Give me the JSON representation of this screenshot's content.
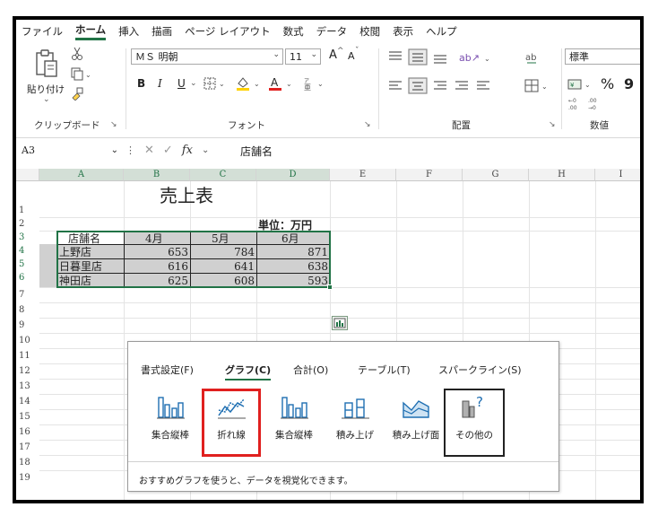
{
  "menu": {
    "items": [
      "ファイル",
      "ホーム",
      "挿入",
      "描画",
      "ページ レイアウト",
      "数式",
      "データ",
      "校閲",
      "表示",
      "ヘルプ"
    ],
    "active_index": 1
  },
  "ribbon": {
    "clipboard": {
      "paste_label": "貼り付け",
      "group_label": "クリップボード"
    },
    "font": {
      "font_name": "ＭＳ 明朝",
      "font_size": "11",
      "bold": "B",
      "italic": "I",
      "underline": "U",
      "grow": "A",
      "shrink": "A",
      "group_label": "フォント"
    },
    "alignment": {
      "group_label": "配置"
    },
    "number": {
      "format": "標準",
      "percent": "%",
      "comma": "9",
      "group_label": "数値"
    }
  },
  "formula_bar": {
    "name_box": "A3",
    "fx": "fx",
    "formula": "店舗名"
  },
  "grid": {
    "columns": [
      "A",
      "B",
      "C",
      "D",
      "E",
      "F",
      "G",
      "H",
      "I"
    ],
    "rows": [
      "1",
      "2",
      "3",
      "4",
      "5",
      "6",
      "7",
      "8",
      "9",
      "10",
      "11",
      "12",
      "13",
      "14",
      "15",
      "16",
      "17",
      "18",
      "19"
    ],
    "title": "売上表",
    "unit": "単位：万円",
    "headers": [
      "店舗名",
      "4月",
      "5月",
      "6月"
    ],
    "data": [
      [
        "上野店",
        "653",
        "784",
        "871"
      ],
      [
        "日暮里店",
        "616",
        "641",
        "638"
      ],
      [
        "神田店",
        "625",
        "608",
        "593"
      ]
    ]
  },
  "quick_analysis": {
    "tabs": [
      "書式設定(F)",
      "グラフ(C)",
      "合計(O)",
      "テーブル(T)",
      "スパークライン(S)"
    ],
    "active_tab": 1,
    "items": [
      "集合縦棒",
      "折れ線",
      "集合縦棒",
      "積み上げ",
      "積み上げ面",
      "その他の"
    ],
    "footer": "おすすめグラフを使うと、データを視覚化できます。"
  },
  "colors": {
    "accent": "#217346",
    "highlight": "#e0201f",
    "chart_icon": "#1f6fb2",
    "selection_fill": "#d0d0d0"
  }
}
